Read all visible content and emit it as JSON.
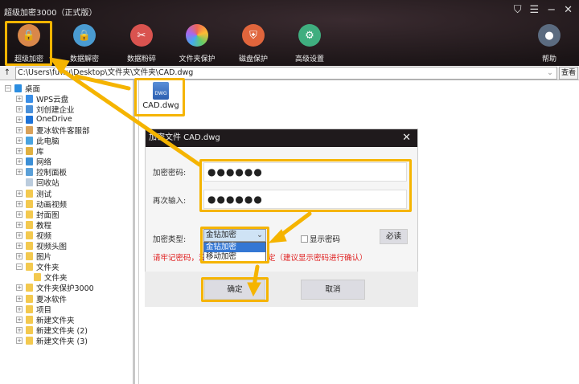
{
  "app": {
    "title": "超级加密3000（正式版）",
    "controls": [
      "skin",
      "menu",
      "minimize",
      "close"
    ]
  },
  "toolbar": [
    {
      "label": "超级加密",
      "color": "#d9874a",
      "icon": "lock-icon"
    },
    {
      "label": "数据解密",
      "color": "#4a9bd1",
      "icon": "unlock-icon"
    },
    {
      "label": "数据粉碎",
      "color": "#d9534f",
      "icon": "scissors-icon"
    },
    {
      "label": "文件夹保护",
      "color": "#e8e0d0",
      "icon": "folder-protect-icon"
    },
    {
      "label": "磁盘保护",
      "color": "#e0653c",
      "icon": "shield-icon"
    },
    {
      "label": "高级设置",
      "color": "#3fae7f",
      "icon": "gear-icon"
    },
    {
      "label": "帮助",
      "color": "#5b6b80",
      "icon": "user-icon"
    }
  ],
  "pathbar": {
    "up": "↑",
    "path": "C:\\Users\\fuwu\\Desktop\\文件夹\\文件夹\\CAD.dwg",
    "view": "查看"
  },
  "tree": [
    {
      "label": "桌面",
      "level": 0
    },
    {
      "label": "WPS云盘",
      "level": 1
    },
    {
      "label": "刘创建企业",
      "level": 1
    },
    {
      "label": "OneDrive",
      "level": 1
    },
    {
      "label": "夏冰软件客服部",
      "level": 1
    },
    {
      "label": "此电脑",
      "level": 1
    },
    {
      "label": "库",
      "level": 1
    },
    {
      "label": "网络",
      "level": 1
    },
    {
      "label": "控制面板",
      "level": 1
    },
    {
      "label": "回收站",
      "level": 1
    },
    {
      "label": "测试",
      "level": 1
    },
    {
      "label": "动画视频",
      "level": 1
    },
    {
      "label": "封面图",
      "level": 1
    },
    {
      "label": "教程",
      "level": 1
    },
    {
      "label": "视频",
      "level": 1
    },
    {
      "label": "视频头图",
      "level": 1
    },
    {
      "label": "图片",
      "level": 1
    },
    {
      "label": "文件夹",
      "level": 1
    },
    {
      "label": "文件夹",
      "level": 2
    },
    {
      "label": "文件夹保护3000",
      "level": 1
    },
    {
      "label": "夏冰软件",
      "level": 1
    },
    {
      "label": "项目",
      "level": 1
    },
    {
      "label": "新建文件夹",
      "level": 1
    },
    {
      "label": "新建文件夹 (2)",
      "level": 1
    },
    {
      "label": "新建文件夹 (3)",
      "level": 1
    }
  ],
  "file": {
    "name": "CAD.dwg",
    "badge": "DWG"
  },
  "dialog": {
    "title": "加密文件 CAD.dwg",
    "password_label": "加密密码:",
    "password_value": "●●●●●●",
    "confirm_label": "再次输入:",
    "confirm_value": "●●●●●●",
    "type_label": "加密类型:",
    "type_selected": "金钻加密",
    "type_options": [
      "金钻加密",
      "移动加密"
    ],
    "show_password": "显示密码",
    "must_read": "必读",
    "warning_left": "请牢记密码，没",
    "warning_right": "定（建议显示密码进行确认）",
    "ok": "确定",
    "cancel": "取消"
  },
  "colors": {
    "highlight": "#f5b400",
    "warning": "#e02020"
  }
}
